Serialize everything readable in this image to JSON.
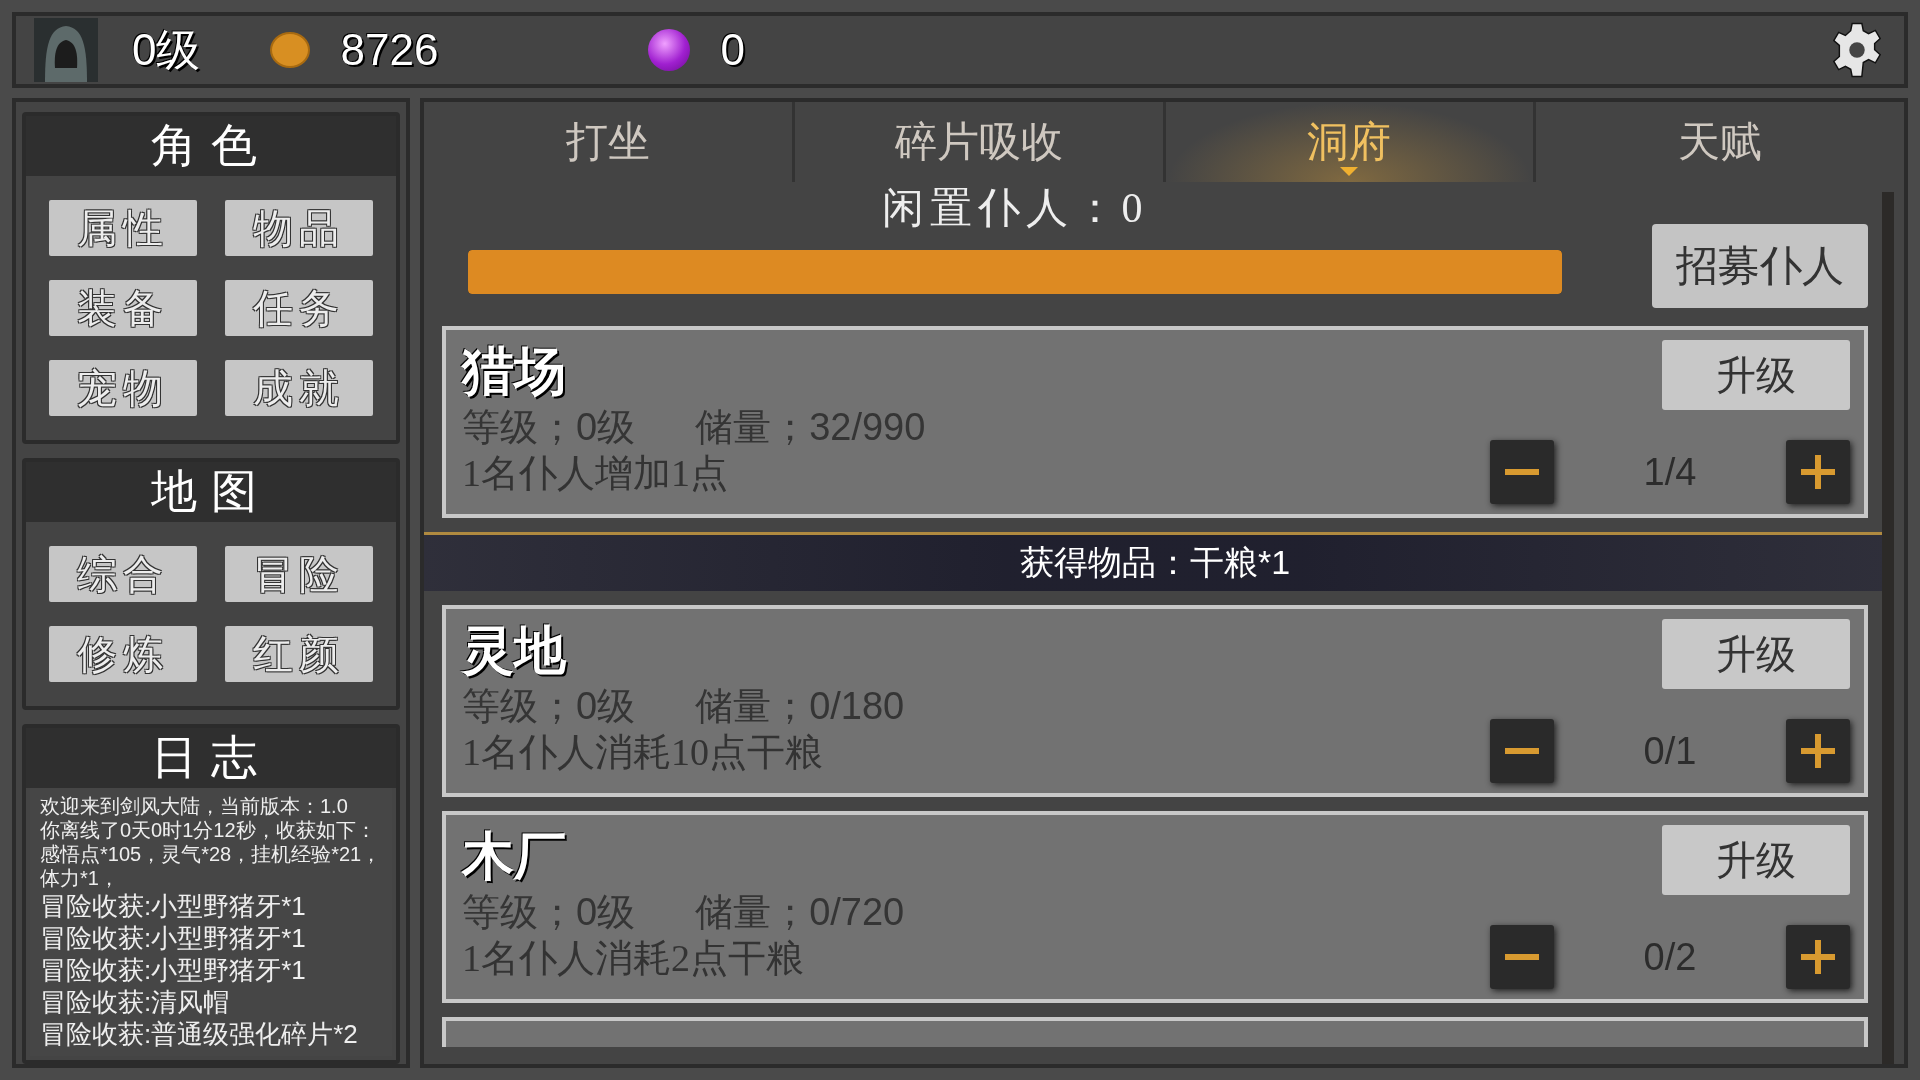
{
  "header": {
    "level": "0级",
    "coins": "8726",
    "gems": "0"
  },
  "sidebar": {
    "sections": [
      {
        "title": "角色",
        "buttons": [
          "属性",
          "物品",
          "装备",
          "任务",
          "宠物",
          "成就"
        ]
      },
      {
        "title": "地图",
        "buttons": [
          "综合",
          "冒险",
          "修炼",
          "红颜"
        ]
      }
    ],
    "log": {
      "title": "日志",
      "entries": [
        {
          "kind": "small",
          "text": "欢迎来到剑风大陆，当前版本：1.0"
        },
        {
          "kind": "small",
          "text": "你离线了0天0时1分12秒，收获如下："
        },
        {
          "kind": "small",
          "text": "感悟点*105，灵气*28，挂机经验*21，"
        },
        {
          "kind": "small",
          "text": "体力*1，"
        },
        {
          "kind": "normal",
          "text": "冒险收获:小型野猪牙*1"
        },
        {
          "kind": "normal",
          "text": "冒险收获:小型野猪牙*1"
        },
        {
          "kind": "normal",
          "text": "冒险收获:小型野猪牙*1"
        },
        {
          "kind": "normal",
          "text": "冒险收获:清风帽"
        },
        {
          "kind": "normal",
          "text": "冒险收获:普通级强化碎片*2"
        }
      ]
    }
  },
  "tabs": [
    {
      "label": "打坐",
      "selected": false
    },
    {
      "label": "碎片吸收",
      "selected": false
    },
    {
      "label": "洞府",
      "selected": true
    },
    {
      "label": "天赋",
      "selected": false
    }
  ],
  "servants": {
    "label": "闲置仆人：0",
    "level": 1.0,
    "button": "招募仆人"
  },
  "buildings": [
    {
      "name": "猎场",
      "grade": "等级；0级",
      "storage": "储量；32/990",
      "effect": "1名仆人增加1点",
      "assigned": "1/4",
      "upgrade": "升级",
      "toast": "获得物品：干粮*1"
    },
    {
      "name": "灵地",
      "grade": "等级；0级",
      "storage": "储量；0/180",
      "effect": "1名仆人消耗10点干粮",
      "assigned": "0/1",
      "upgrade": "升级"
    },
    {
      "name": "木厂",
      "grade": "等级；0级",
      "storage": "储量；0/720",
      "effect": "1名仆人消耗2点干粮",
      "assigned": "0/2",
      "upgrade": "升级"
    }
  ]
}
